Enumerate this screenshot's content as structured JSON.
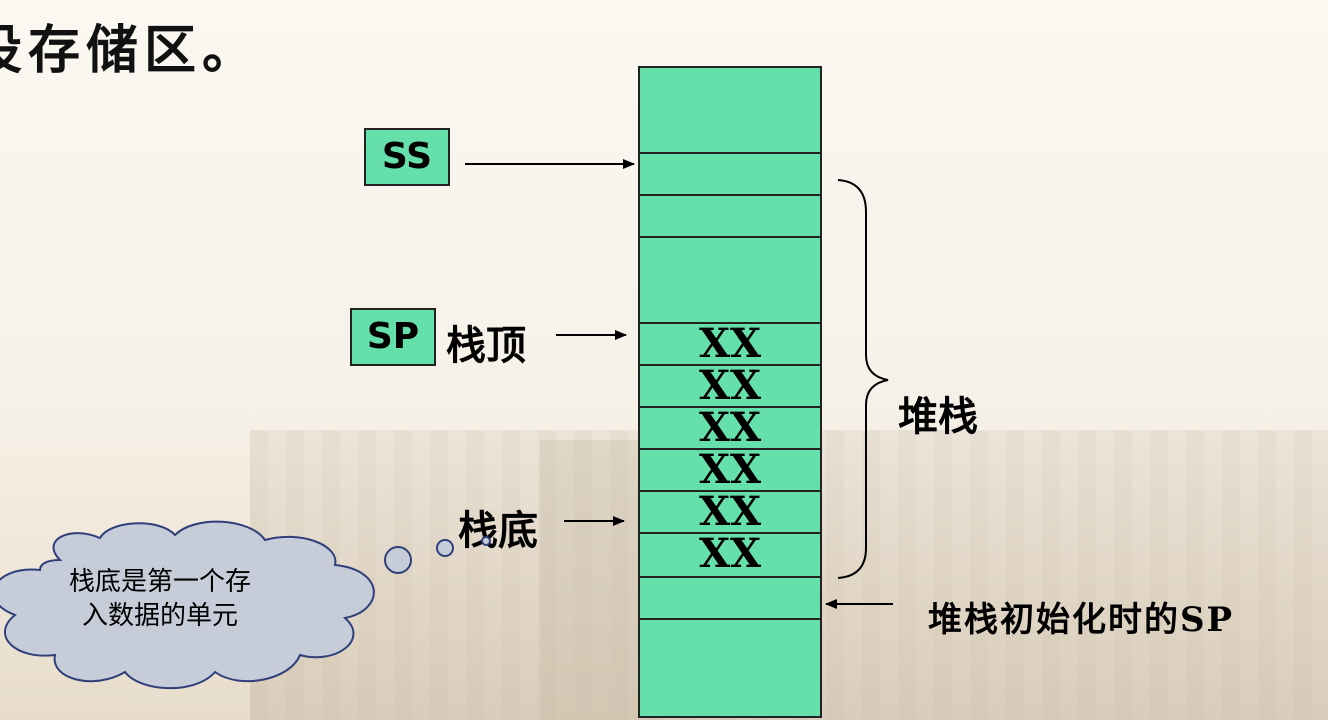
{
  "heading": "设存储区。",
  "registers": {
    "ss": "SS",
    "sp": "SP"
  },
  "labels": {
    "stack_top": "栈顶",
    "stack_bottom": "栈底",
    "stack": "堆栈",
    "initial_sp": "堆栈初始化时的SP"
  },
  "memory_cells": [
    "",
    "",
    "",
    "",
    "XX",
    "XX",
    "XX",
    "XX",
    "XX",
    "XX",
    "",
    ""
  ],
  "callout": {
    "line1": "栈底是第一个存",
    "line2": "入数据的单元"
  },
  "colors": {
    "cell_fill": "#66e0aa",
    "callout_fill": "#c7ccd9",
    "border": "#222222"
  }
}
